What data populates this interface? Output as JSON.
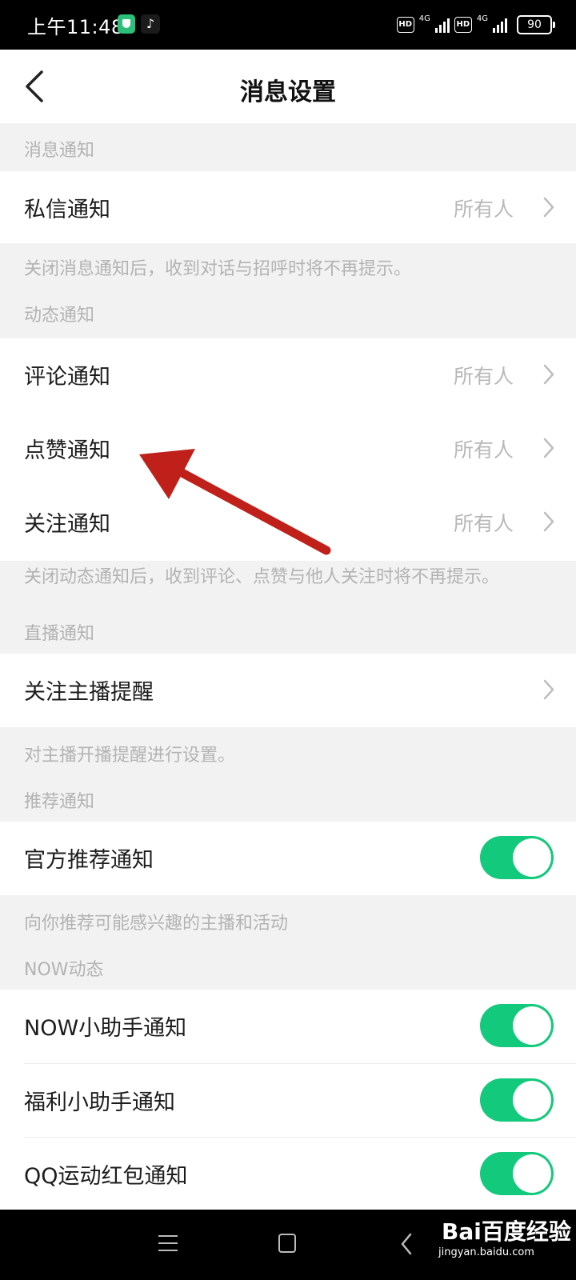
{
  "status_bar": {
    "time": "上午11:48",
    "hd1": "HD",
    "net1": "4G",
    "hd2": "HD",
    "net2": "4G",
    "battery": "90",
    "icons": [
      "shield-app-icon",
      "tiktok-app-icon",
      "signal-icon",
      "battery-icon"
    ]
  },
  "header": {
    "title": "消息设置",
    "back_icon": "chevron-left-icon"
  },
  "sections": {
    "message": {
      "label": "消息通知",
      "hint": "关闭消息通知后，收到对话与招呼时将不再提示。",
      "items": [
        {
          "label": "私信通知",
          "value": "所有人"
        }
      ]
    },
    "activity": {
      "label": "动态通知",
      "hint": "关闭动态通知后，收到评论、点赞与他人关注时将不再提示。",
      "items": [
        {
          "label": "评论通知",
          "value": "所有人"
        },
        {
          "label": "点赞通知",
          "value": "所有人"
        },
        {
          "label": "关注通知",
          "value": "所有人"
        }
      ]
    },
    "live": {
      "label": "直播通知",
      "hint": "对主播开播提醒进行设置。",
      "items": [
        {
          "label": "关注主播提醒"
        }
      ]
    },
    "recommend": {
      "label": "推荐通知",
      "hint": "向你推荐可能感兴趣的主播和活动",
      "items": [
        {
          "label": "官方推荐通知",
          "on": true
        }
      ]
    },
    "now": {
      "label": "NOW动态",
      "items": [
        {
          "label": "NOW小助手通知",
          "on": true
        },
        {
          "label": "福利小助手通知",
          "on": true
        },
        {
          "label": "QQ运动红包通知",
          "on": true
        }
      ]
    }
  },
  "colors": {
    "toggle_on": "#12c97c",
    "annotation_arrow": "#c0201a",
    "section_bg": "#f2f2f2"
  },
  "nav_bar": {
    "icons": [
      "menu-icon",
      "home-icon",
      "back-icon"
    ]
  },
  "watermark": {
    "brand": "Bai百度经验",
    "url": "jingyan.baidu.com"
  }
}
